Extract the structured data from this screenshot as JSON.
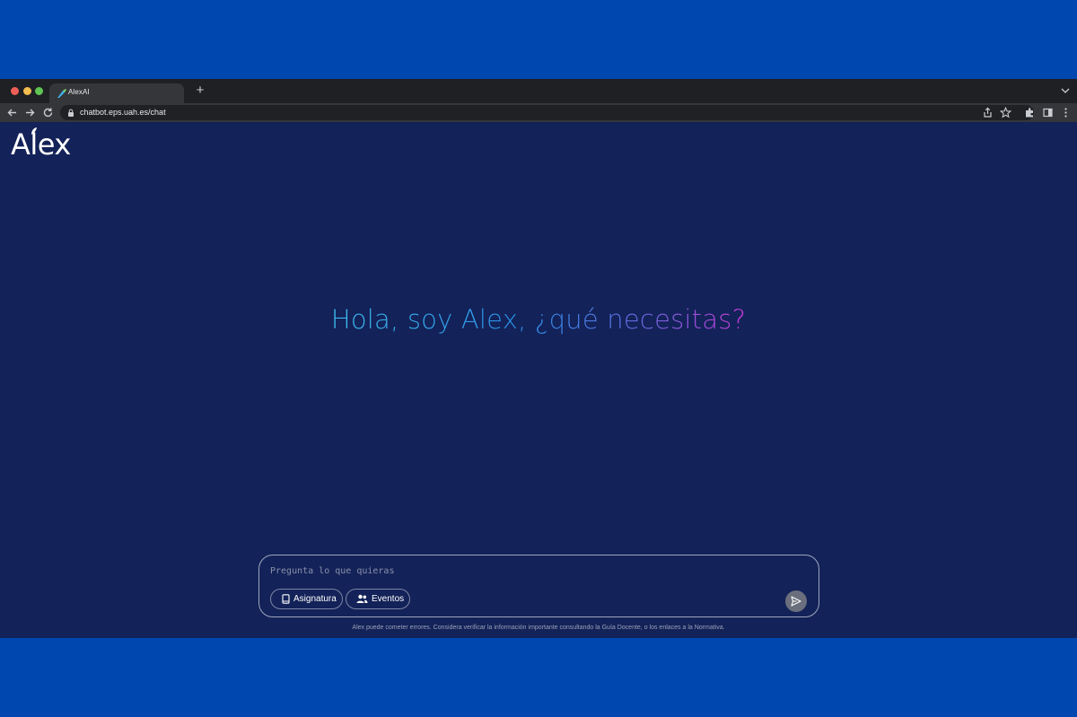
{
  "browser": {
    "tab_title": "AlexAI",
    "new_tab_symbol": "+",
    "url": "chatbot.eps.uah.es/chat",
    "icons": [
      "back-icon",
      "forward-icon",
      "reload-icon",
      "lock-icon",
      "share-icon",
      "bookmark-star-icon",
      "extensions-icon",
      "sidepanel-icon",
      "kebab-menu-icon",
      "tab-list-chevron-icon"
    ]
  },
  "app": {
    "logo_text": "Alex",
    "greeting": "Hola, soy Alex, ¿qué necesitas?",
    "gradient_colors": [
      "#3fb9ee",
      "#2a8fe6",
      "#5a6fe0",
      "#c43ad6"
    ]
  },
  "composer": {
    "placeholder": "Pregunta lo que quieras",
    "chips": [
      {
        "label": "Asignatura",
        "icon": "book-icon"
      },
      {
        "label": "Eventos",
        "icon": "users-icon"
      }
    ],
    "send_icon": "send-icon"
  },
  "footer": {
    "disclaimer": "Alex puede cometer errores. Considera verificar la información importante consultando la Guía Docente, o los enlaces a la Normativa."
  },
  "colors": {
    "page_bg": "#132258",
    "outer_bg": "#0048b0"
  }
}
